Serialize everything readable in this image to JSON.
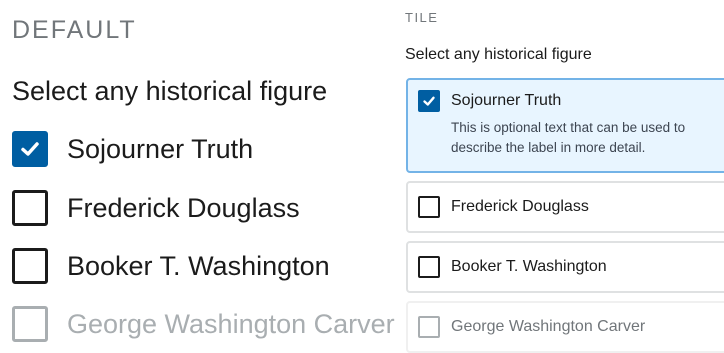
{
  "default_section": {
    "heading": "DEFAULT",
    "legend": "Select any historical figure",
    "options": [
      {
        "label": "Sojourner Truth",
        "checked": true,
        "disabled": false
      },
      {
        "label": "Frederick Douglass",
        "checked": false,
        "disabled": false
      },
      {
        "label": "Booker T. Washington",
        "checked": false,
        "disabled": false
      },
      {
        "label": "George Washington Carver",
        "checked": false,
        "disabled": true
      }
    ]
  },
  "tile_section": {
    "heading": "TILE",
    "legend": "Select any historical figure",
    "options": [
      {
        "label": "Sojourner Truth",
        "description": "This is optional text that can be used to describe the label in more detail.",
        "checked": true,
        "disabled": false
      },
      {
        "label": "Frederick Douglass",
        "checked": false,
        "disabled": false
      },
      {
        "label": "Booker T. Washington",
        "checked": false,
        "disabled": false
      },
      {
        "label": "George Washington Carver",
        "checked": false,
        "disabled": true
      }
    ]
  },
  "colors": {
    "primary": "#005ea2",
    "tile_checked_bg": "#e8f5ff",
    "tile_checked_border": "#73b3e7",
    "disabled": "#a9aeb1"
  }
}
